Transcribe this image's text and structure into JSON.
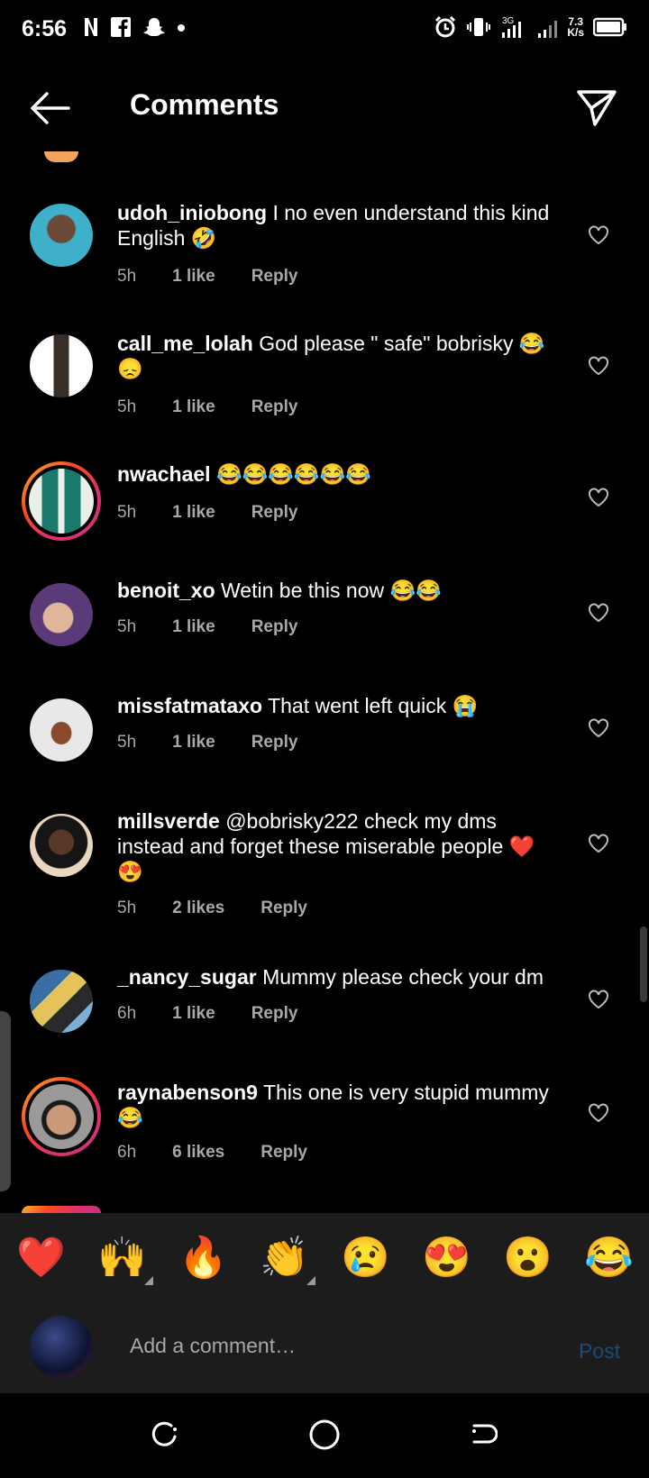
{
  "status_bar": {
    "time": "6:56",
    "net_speed": "7.3",
    "net_unit": "K/s",
    "signal_label": "3G"
  },
  "header": {
    "title": "Comments"
  },
  "comments": [
    {
      "username": "udoh_iniobong",
      "text": "I no even understand this kind English 🤣",
      "time": "5h",
      "likes": "1 like",
      "reply": "Reply"
    },
    {
      "username": "call_me_lolah",
      "text": "God please \" safe\"  bobrisky 😂😞",
      "time": "5h",
      "likes": "1 like",
      "reply": "Reply"
    },
    {
      "username": "nwachael",
      "text": "😂😂😂😂😂😂",
      "time": "5h",
      "likes": "1 like",
      "reply": "Reply"
    },
    {
      "username": "benoit_xo",
      "text": "Wetin be this now 😂😂",
      "time": "5h",
      "likes": "1 like",
      "reply": "Reply"
    },
    {
      "username": "missfatmataxo",
      "text": "That went left quick 😭",
      "time": "5h",
      "likes": "1 like",
      "reply": "Reply"
    },
    {
      "username": "millsverde",
      "text": "@bobrisky222 check my dms instead and forget these miserable people ❤️😍",
      "time": "5h",
      "likes": "2 likes",
      "reply": "Reply"
    },
    {
      "username": "_nancy_sugar",
      "text": "Mummy please check your dm",
      "time": "6h",
      "likes": "1 like",
      "reply": "Reply"
    },
    {
      "username": "raynabenson9",
      "text": "This one is very stupid mummy 😂",
      "time": "6h",
      "likes": "6 likes",
      "reply": "Reply"
    }
  ],
  "emoji_bar": [
    "❤️",
    "🙌",
    "🔥",
    "👏",
    "😢",
    "😍",
    "😮",
    "😂"
  ],
  "composer": {
    "placeholder": "Add a comment…",
    "post_label": "Post"
  },
  "colors": {
    "background": "#000000",
    "secondary_text": "#a8a8a8",
    "panel": "#1c1c1c",
    "post_disabled": "#1c4a7a"
  }
}
